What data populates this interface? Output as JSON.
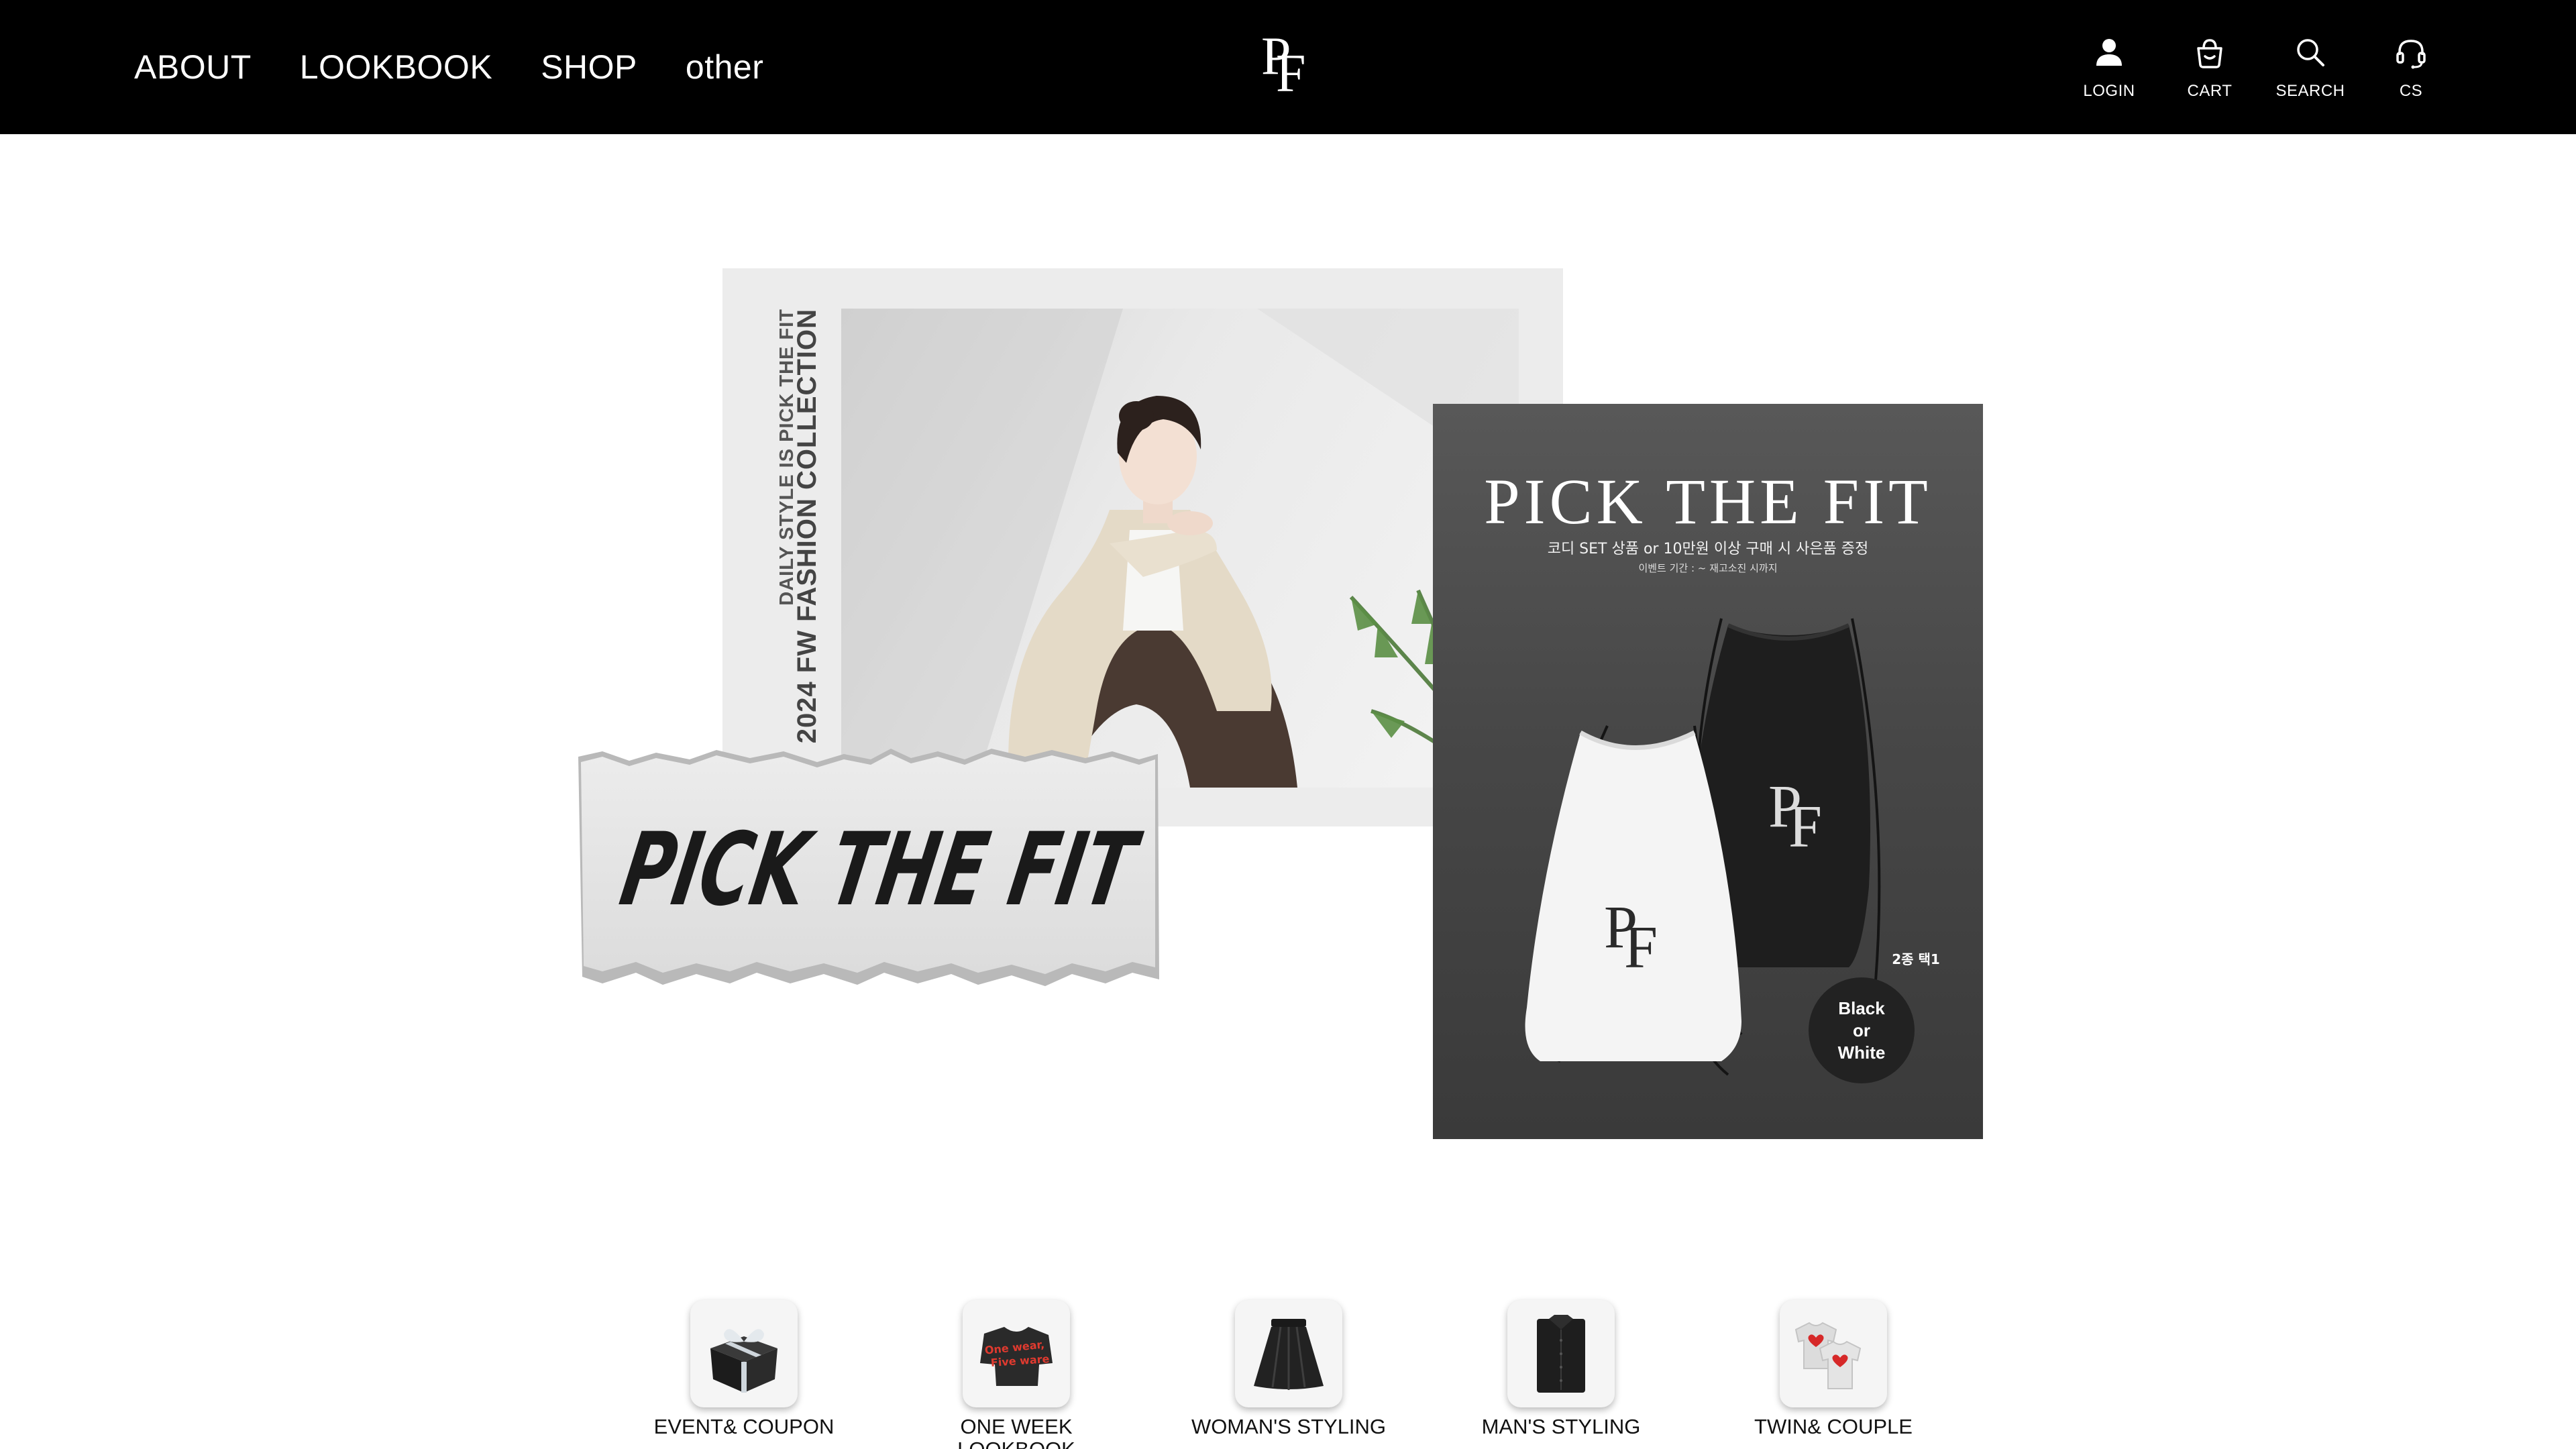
{
  "header": {
    "nav": [
      {
        "label": "ABOUT"
      },
      {
        "label": "LOOKBOOK"
      },
      {
        "label": "SHOP"
      },
      {
        "label": "other"
      }
    ],
    "logo_text": "PF",
    "utils": [
      {
        "label": "LOGIN",
        "icon": "user-icon"
      },
      {
        "label": "CART",
        "icon": "basket-icon"
      },
      {
        "label": "SEARCH",
        "icon": "search-icon"
      },
      {
        "label": "CS",
        "icon": "headset-icon"
      }
    ]
  },
  "banner": {
    "vertical_line1": "DAILY STYLE IS PICK THE FIT",
    "vertical_line2": "2024 FW FASHION COLLECTION",
    "brush_logo": "PICK THE FIT",
    "promo": {
      "title": "PICK THE FIT",
      "subtitle": "코디 SET 상품 or 10만원 이상 구매 시 사은품 증정",
      "period": "이벤트 기간 : ~ 재고소진 시까지",
      "bag_logo": "PF",
      "choice": "2종 택1",
      "badge": [
        "Black",
        "or",
        "White"
      ]
    }
  },
  "categories": [
    {
      "label": "EVENT& COUPON",
      "icon": "gift-box-icon"
    },
    {
      "label": "ONE WEEK LOOKBOOK",
      "icon": "one-wear-five-ware-icon",
      "icon_text": [
        "One wear,",
        "Five ware"
      ]
    },
    {
      "label": "WOMAN'S STYLING",
      "icon": "skirt-icon"
    },
    {
      "label": "MAN'S STYLING",
      "icon": "shirt-icon"
    },
    {
      "label": "TWIN& COUPLE",
      "icon": "couple-tshirt-icon"
    }
  ],
  "colors": {
    "header_bg": "#000000",
    "page_bg": "#ffffff",
    "promo_bg": "#474747",
    "accent_red": "#d62828"
  }
}
